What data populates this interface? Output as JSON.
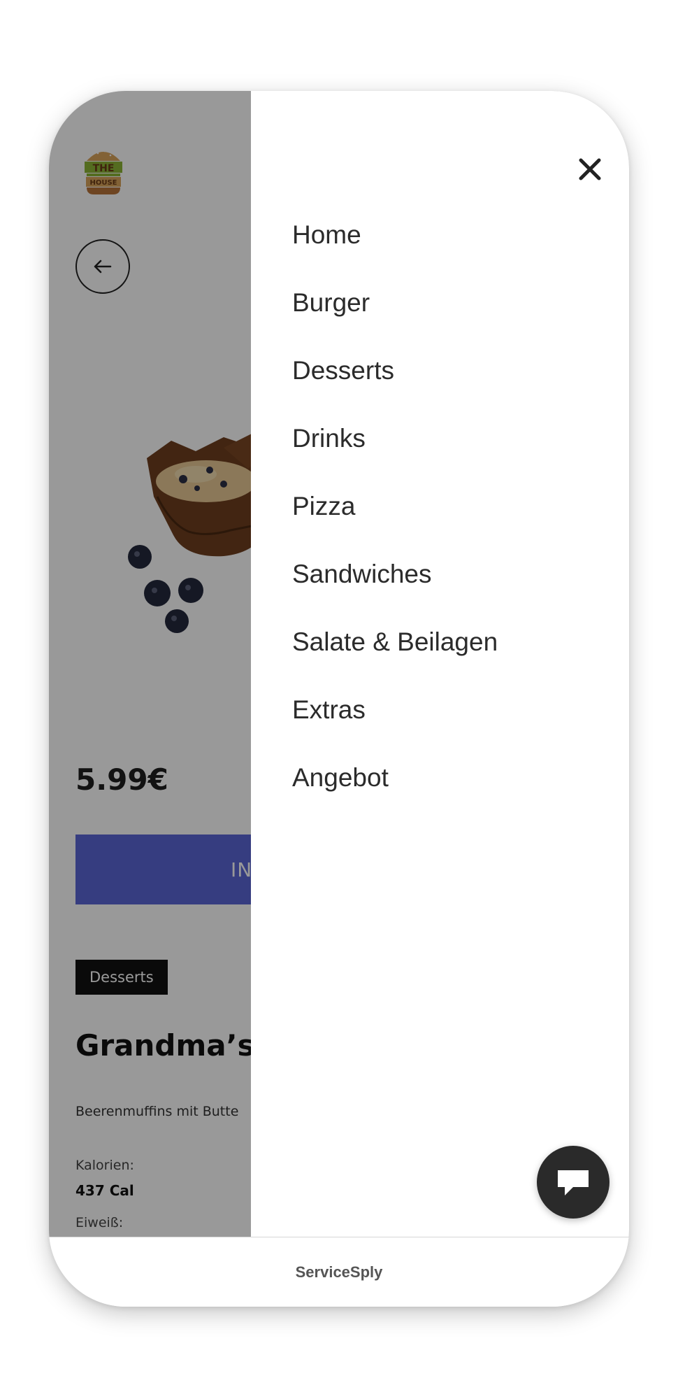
{
  "brand": {
    "logo_text_top": "THE",
    "logo_text_bottom": "HOUSE"
  },
  "product": {
    "price": "5.99€",
    "add_button_label": "IN",
    "category": "Desserts",
    "title": "Grandma’s I",
    "description": "Beerenmuffins mit Butte",
    "nutrition": {
      "calories_label": "Kalorien:",
      "calories_value": "437 Cal",
      "protein_label": "Eiweiß:"
    }
  },
  "menu": {
    "items": [
      {
        "label": "Home"
      },
      {
        "label": "Burger"
      },
      {
        "label": "Desserts"
      },
      {
        "label": "Drinks"
      },
      {
        "label": "Pizza"
      },
      {
        "label": "Sandwiches"
      },
      {
        "label": "Salate & Beilagen"
      },
      {
        "label": "Extras"
      },
      {
        "label": "Angebot"
      }
    ]
  },
  "footer": {
    "brand": "ServiceSply"
  },
  "icons": {
    "close": "close-icon",
    "back": "arrow-left-icon",
    "chat": "chat-icon"
  },
  "colors": {
    "accent": "#5a66d6",
    "overlay": "rgba(0,0,0,0.40)",
    "badge": "#111111",
    "fab": "#2a2a2a"
  }
}
